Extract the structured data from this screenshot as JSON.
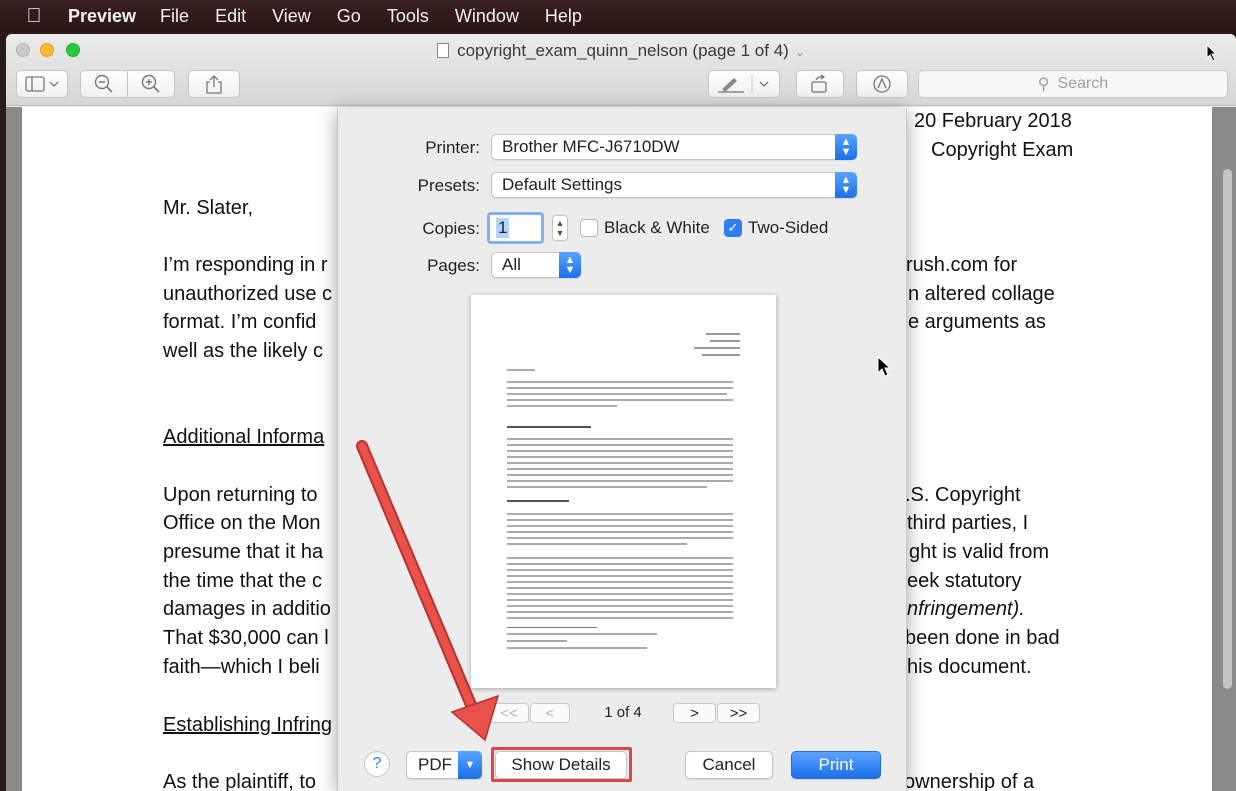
{
  "menubar": {
    "apple_icon": "apple-logo",
    "items": [
      "Preview",
      "File",
      "Edit",
      "View",
      "Go",
      "Tools",
      "Window",
      "Help"
    ]
  },
  "window": {
    "title": "copyright_exam_quinn_nelson (page 1 of 4)",
    "search_placeholder": "Search"
  },
  "document": {
    "date": "20 February 2018",
    "course": "Copyright Exam",
    "salutation": "Mr. Slater,",
    "lines": [
      "I’m responding in r",
      "unauthorized use c",
      "format. I’m confid",
      "well as the likely c"
    ],
    "right_lines": [
      "rush.com for",
      "n altered collage",
      "e arguments as"
    ],
    "heading1": "Additional Informa",
    "para2": [
      "Upon returning to",
      "Office on the Mon",
      "presume that it ha",
      "the time that the c",
      "damages in additio",
      "That $30,000 can l",
      "faith—which I beli"
    ],
    "para2_right": [
      ".S. Copyright",
      " third parties, I",
      "ght is valid from",
      "eek statutory",
      "nfringement).",
      "been done in bad",
      "his document."
    ],
    "heading2": "Establishing Infring",
    "last_line": "As the plaintiff, to",
    "last_right": "ownership of a"
  },
  "print": {
    "printer_label": "Printer:",
    "printer_value": "Brother MFC-J6710DW",
    "presets_label": "Presets:",
    "presets_value": "Default Settings",
    "copies_label": "Copies:",
    "copies_value": "1",
    "bw_label": "Black & White",
    "bw_checked": false,
    "twosided_label": "Two-Sided",
    "twosided_checked": true,
    "pages_label": "Pages:",
    "pages_value": "All",
    "page_indicator": "1 of 4",
    "first_label": "<<",
    "prev_label": "<",
    "next_label": ">",
    "last_label": ">>",
    "help_label": "?",
    "pdf_label": "PDF",
    "details_label": "Show Details",
    "cancel_label": "Cancel",
    "print_label": "Print"
  },
  "colors": {
    "accent": "#2d7ff2",
    "annotation": "#e2443f"
  }
}
